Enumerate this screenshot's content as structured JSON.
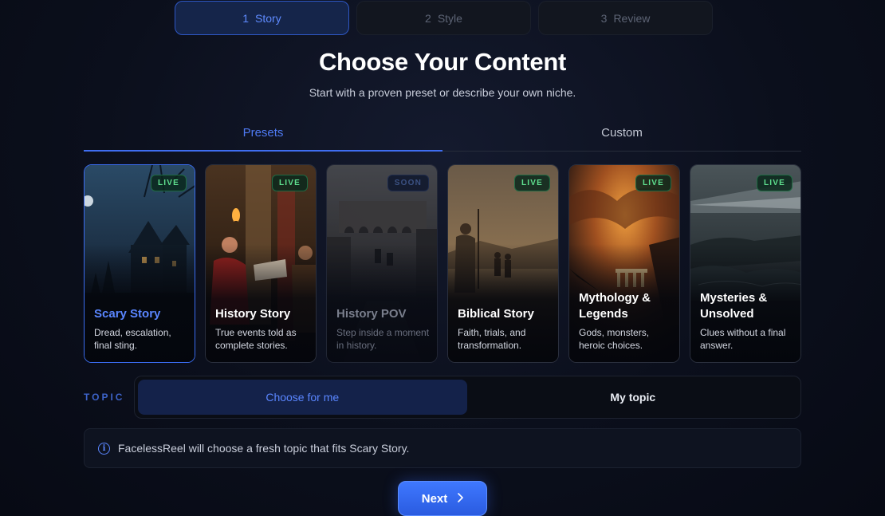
{
  "stepper": {
    "steps": [
      {
        "num": "1",
        "label": "Story"
      },
      {
        "num": "2",
        "label": "Style"
      },
      {
        "num": "3",
        "label": "Review"
      }
    ],
    "active_index": 0
  },
  "header": {
    "title": "Choose Your Content",
    "subtitle": "Start with a proven preset or describe your own niche."
  },
  "tabs": [
    {
      "label": "Presets",
      "active": true
    },
    {
      "label": "Custom",
      "active": false
    }
  ],
  "presets": [
    {
      "title": "Scary Story",
      "desc": "Dread, escalation, final sting.",
      "badge": "LIVE",
      "selected": true
    },
    {
      "title": "History Story",
      "desc": "True events told as complete stories.",
      "badge": "LIVE",
      "selected": false
    },
    {
      "title": "History POV",
      "desc": "Step inside a moment in history.",
      "badge": "SOON",
      "selected": false
    },
    {
      "title": "Biblical Story",
      "desc": "Faith, trials, and transformation.",
      "badge": "LIVE",
      "selected": false
    },
    {
      "title": "Mythology & Legends",
      "desc": "Gods, monsters, heroic choices.",
      "badge": "LIVE",
      "selected": false
    },
    {
      "title": "Mysteries & Unsolved",
      "desc": "Clues without a final answer.",
      "badge": "LIVE",
      "selected": false
    }
  ],
  "topic": {
    "label": "TOPIC",
    "options": [
      "Choose for me",
      "My topic"
    ],
    "active_option": "Choose for me"
  },
  "info": {
    "icon": "info-icon",
    "text": "FacelessReel will choose a fresh topic that fits Scary Story."
  },
  "next_button": {
    "label": "Next",
    "icon": "chevron-right-icon"
  },
  "colors": {
    "accent": "#3f6df0",
    "live_badge": "#5fe08f",
    "background": "#0b0f1c"
  }
}
